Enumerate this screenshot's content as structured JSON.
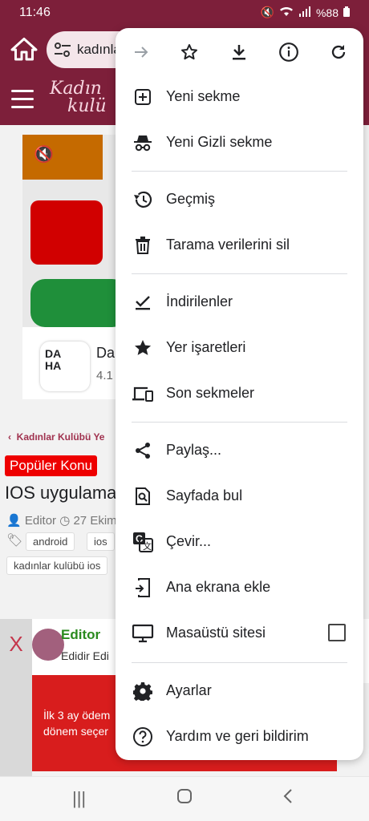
{
  "status": {
    "time": "11:46",
    "battery": "%88"
  },
  "browser": {
    "url_text": "kadınla"
  },
  "site": {
    "logo_line1": "Kadın",
    "logo_line2": "kulü"
  },
  "ad": {
    "app_logo_line1": "DA",
    "app_logo_line2": "HA",
    "app_name": "Da",
    "rating": "4.1"
  },
  "article": {
    "breadcrumb": "Kadınlar Kulübü Ye",
    "badge": "Popüler Konu",
    "title": "IOS uygulama",
    "meta": "Editor ◷ 27 Ekim",
    "tags": [
      "android",
      "ios",
      "kadınlar kulübü ios"
    ]
  },
  "author": {
    "close": "X",
    "name": "Editor",
    "sub": "Edidir Edi"
  },
  "promo": {
    "line1": "İlk 3 ay ödem",
    "line2": "dönem seçer"
  },
  "menu": {
    "top_icons": [
      "forward-icon",
      "star-icon",
      "download-icon",
      "info-icon",
      "refresh-icon"
    ],
    "items": [
      {
        "label": "Yeni sekme"
      },
      {
        "label": "Yeni Gizli sekme"
      },
      {
        "label": "Geçmiş"
      },
      {
        "label": "Tarama verilerini sil"
      },
      {
        "label": "İndirilenler"
      },
      {
        "label": "Yer işaretleri"
      },
      {
        "label": "Son sekmeler"
      },
      {
        "label": "Paylaş..."
      },
      {
        "label": "Sayfada bul"
      },
      {
        "label": "Çevir..."
      },
      {
        "label": "Ana ekrana ekle"
      },
      {
        "label": "Masaüstü sitesi",
        "checked": false
      },
      {
        "label": "Ayarlar"
      },
      {
        "label": "Yardım ve geri bildirim"
      }
    ]
  }
}
